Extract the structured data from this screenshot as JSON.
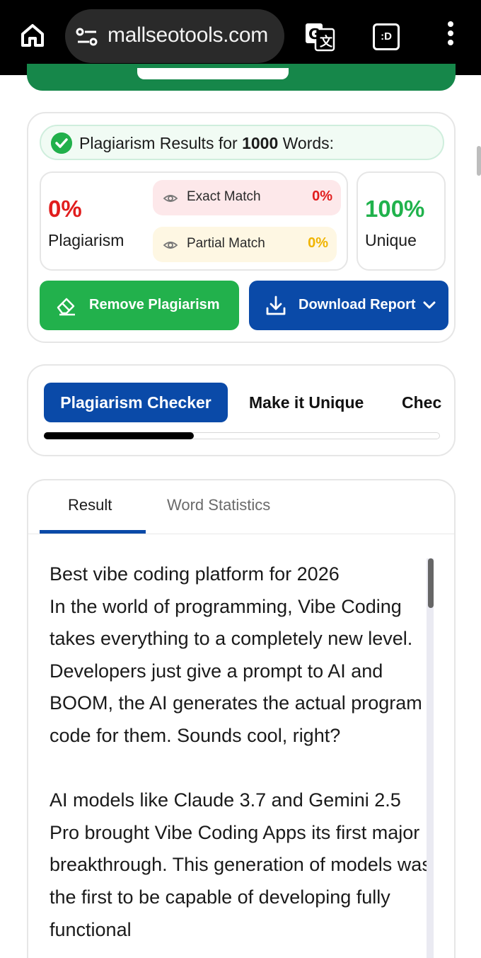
{
  "browser": {
    "url": "mallseotools.com",
    "tab_switch_label": ":D"
  },
  "results": {
    "title_prefix": "Plagiarism Results for ",
    "word_count": "1000",
    "title_suffix": " Words:",
    "plagiarism_percent": "0%",
    "plagiarism_label": "Plagiarism",
    "exact_match_label": "Exact Match",
    "exact_match_value": "0%",
    "partial_match_label": "Partial Match",
    "partial_match_value": "0%",
    "unique_percent": "100%",
    "unique_label": "Unique",
    "remove_button": "Remove Plagiarism",
    "download_button": "Download Report"
  },
  "tools": {
    "tabs": [
      {
        "label": "Plagiarism Checker"
      },
      {
        "label": "Make it Unique"
      },
      {
        "label": "Chec"
      }
    ]
  },
  "result_panel": {
    "tabs": [
      {
        "label": "Result"
      },
      {
        "label": "Word Statistics"
      }
    ],
    "paragraphs": [
      "Best vibe coding platform for 2026",
      "In the world of programming, Vibe Coding takes everything to a completely new level. Developers just give a prompt to AI and BOOM, the AI generates the actual program code for them. Sounds cool, right?",
      "AI models like Claude 3.7 and Gemini 2.5 Pro brought Vibe Coding Apps its first major breakthrough. This generation of models was the first to be capable of developing fully functional"
    ]
  },
  "colors": {
    "accent_blue": "#0a4aa8",
    "accent_green": "#22b14c",
    "danger_red": "#e11d1d",
    "warning_yellow": "#f0b400"
  }
}
